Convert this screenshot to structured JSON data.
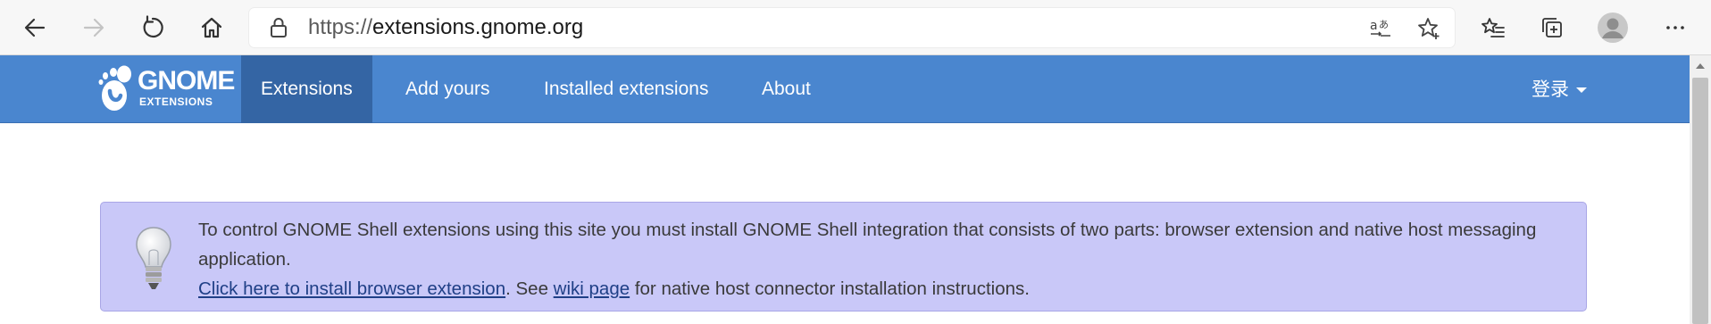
{
  "browser": {
    "url_protocol": "https://",
    "url_host": "extensions.gnome.org",
    "icons": {
      "back": "back-arrow-icon",
      "forward": "forward-arrow-icon",
      "refresh": "refresh-icon",
      "home": "home-icon",
      "lock": "lock-icon",
      "translate": "translate-icon",
      "favorite": "star-add-icon",
      "favorites_list": "favorites-list-icon",
      "collections": "collections-icon",
      "profile": "profile-avatar-icon",
      "more": "more-dots-icon"
    }
  },
  "nav": {
    "logo_name": "GNOME",
    "logo_sub": "EXTENSIONS",
    "items": [
      {
        "label": "Extensions",
        "active": true
      },
      {
        "label": "Add yours",
        "active": false
      },
      {
        "label": "Installed extensions",
        "active": false
      },
      {
        "label": "About",
        "active": false
      }
    ],
    "login_label": "登录"
  },
  "banner": {
    "message": "To control GNOME Shell extensions using this site you must install GNOME Shell integration that consists of two parts: browser extension and native host messaging application.",
    "install_link": "Click here to install browser extension",
    "see_text": ". See ",
    "wiki_link": "wiki page",
    "after_text": " for native host connector installation instructions."
  },
  "colors": {
    "nav_bg": "#4a86cf",
    "nav_active_bg": "#3465a4",
    "banner_bg": "#c9c8f8",
    "banner_border": "#a9a6e6",
    "link": "#1f3f86"
  }
}
